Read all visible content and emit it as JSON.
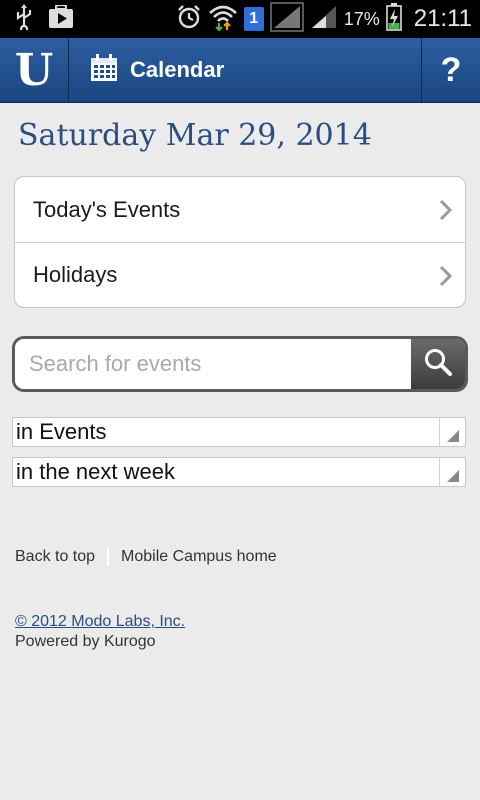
{
  "status_bar": {
    "battery_percent": "17%",
    "time": "21:11",
    "sim_badge": "1",
    "icons": [
      "usb-icon",
      "play-store-icon",
      "alarm-icon",
      "wifi-icon",
      "sim-icon",
      "signal-icon",
      "battery-charging-icon"
    ]
  },
  "navbar": {
    "logo": "U",
    "title": "Calendar",
    "help": "?"
  },
  "date_heading": "Saturday Mar 29, 2014",
  "list": [
    {
      "label": "Today's Events"
    },
    {
      "label": "Holidays"
    }
  ],
  "search": {
    "placeholder": "Search for events",
    "value": ""
  },
  "filters": {
    "category": "in Events",
    "range": "in the next week"
  },
  "footer": {
    "back_to_top": "Back to top",
    "home": "Mobile Campus home",
    "copyright": "© 2012 Modo Labs, Inc.",
    "powered_by": "Powered by Kurogo"
  },
  "colors": {
    "nav_blue": "#1f4f8f",
    "heading_blue": "#2b4d80",
    "background": "#ebebeb"
  }
}
